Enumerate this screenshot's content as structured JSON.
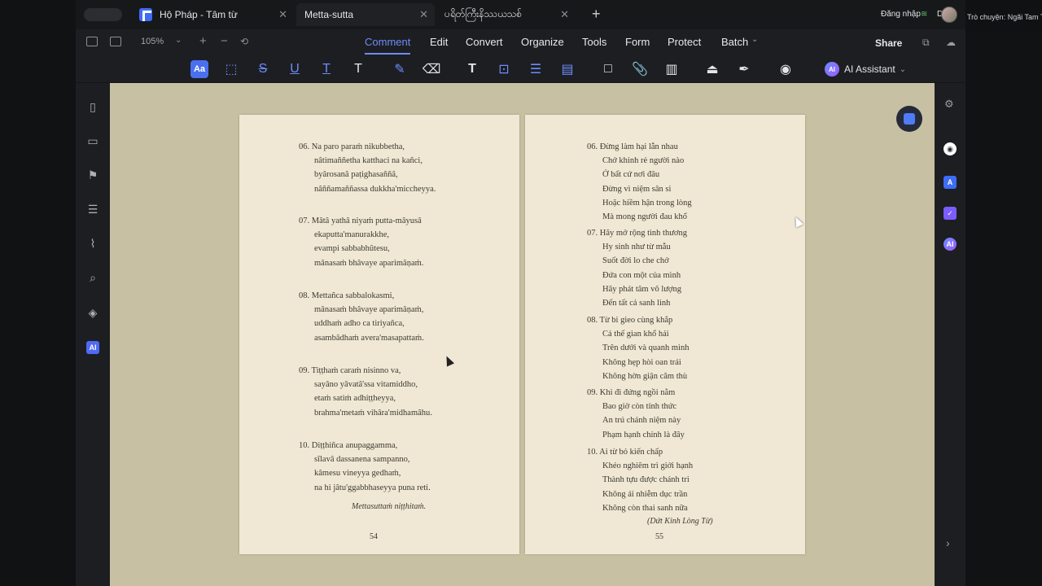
{
  "outer": {
    "right_top_text": "Trò chuyện: Ngãi Tam T"
  },
  "tabs": [
    {
      "label": "Hộ Pháp - Tâm từ"
    },
    {
      "label": "Metta-sutta"
    },
    {
      "label": "ပရိတ်ကြီးနိဿယသစ်"
    }
  ],
  "tabbar_right": {
    "login": "Đăng nhập",
    "translate": "Dịch"
  },
  "toolbar": {
    "zoom": "105%",
    "menu": [
      "Comment",
      "Edit",
      "Convert",
      "Organize",
      "Tools",
      "Form",
      "Protect",
      "Batch"
    ],
    "share": "Share",
    "ai_assistant": "AI Assistant",
    "ai_badge": "AI"
  },
  "left_page": {
    "stanzas": [
      [
        "06. Na paro paraṁ nikubbetha,",
        "nâtimaññetha katthaci na kañci,",
        "byârosanâ paṭighasaññâ,",
        "nâññamaññassa dukkha'miccheyya."
      ],
      [
        "07. Mâtâ yathâ niyaṁ putta-mâyusâ",
        "ekaputta'manurakkhe,",
        "evampi sabbabhûtesu,",
        "mânasaṁ bhâvaye aparimâṇaṁ."
      ],
      [
        "08. Mettañca sabbalokasmi,",
        "mânasaṁ bhâvaye aparimâṇaṁ,",
        "uddhaṁ adho ca tiriyañca,",
        "asambâdhaṁ avera'masapattaṁ."
      ],
      [
        "09. Tiṭṭhaṁ caraṁ nisinno va,",
        "sayâno yâvatâ'ssa vitamiddho,",
        "etaṁ satiṁ adhiṭṭheyya,",
        "brahma'metaṁ vihâra'midhamâhu."
      ],
      [
        "10. Diṭṭhiñca anupaggamma,",
        "sîlavâ dassanena sampanno,",
        "kâmesu vineyya gedhaṁ,",
        "na hi jâtu'ggabbhaseyya puna reti."
      ]
    ],
    "closing": "Mettasuttaṁ niṭṭhitaṁ.",
    "page_number": "54"
  },
  "right_page": {
    "stanzas": [
      [
        "06. Đừng làm hại lẫn nhau",
        "Chớ khinh rẻ người nào",
        "Ở bất cứ nơi đâu",
        "Đừng vì niệm sân si",
        "Hoặc hiềm hận trong lòng",
        "Mà mong người đau khổ"
      ],
      [
        "07. Hãy mở rộng tình thương",
        "Hy sinh như từ mẫu",
        "Suốt đời lo che chở",
        "Đứa con một của mình",
        "Hãy phát tâm vô lượng",
        "Đến tất cả sanh linh"
      ],
      [
        "08. Từ bi gieo cùng khắp",
        "Cả thế gian khổ hải",
        "Trên dưới và quanh mình",
        "Không hẹp hòi oan trái",
        "Không hờn giận căm thù"
      ],
      [
        "09. Khi đi đứng ngồi nằm",
        "Bao giờ còn tỉnh thức",
        "An trú chánh niệm này",
        "Phạm hạnh chính là đây"
      ],
      [
        "10. Ai từ bỏ kiến chấp",
        "Khéo nghiêm trì giới hạnh",
        "Thành tựu được chánh tri",
        "Không ái nhiễm dục trần",
        "Không còn thai sanh nữa"
      ]
    ],
    "closing": "(Dứt Kinh Lòng Từ)",
    "page_number": "55"
  },
  "right_sidebar": {
    "ai_label": "AI"
  },
  "left_sidebar": {
    "ai_label": "AI"
  }
}
